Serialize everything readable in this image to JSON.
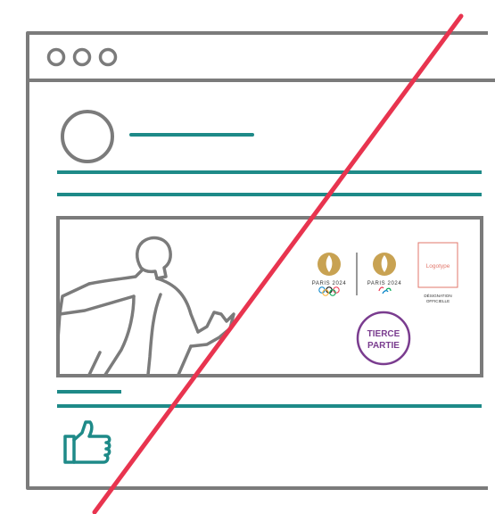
{
  "colors": {
    "outline": "#7b7b7b",
    "teal": "#1e8a88",
    "slash": "#e8344f",
    "gold": "#c8a252",
    "purple": "#7a3c8f",
    "logotype_red": "#e2776b",
    "dark_text": "#333333"
  },
  "window": {
    "traffic_light_icons": [
      "circle-icon",
      "circle-icon",
      "circle-icon"
    ]
  },
  "post": {
    "avatar_icon": "avatar-circle",
    "like_icon": "thumbs-up-icon",
    "athlete_icon": "runner-silhouette"
  },
  "logos": {
    "olympic_brand": "PARIS 2024",
    "paralympic_brand": "PARIS 2024",
    "logotype_label": "Logotype",
    "designation_line1": "DÉSIGNATION",
    "designation_line2": "OFFICIELLE",
    "badge_line1": "TIERCE",
    "badge_line2": "PARTIE"
  }
}
